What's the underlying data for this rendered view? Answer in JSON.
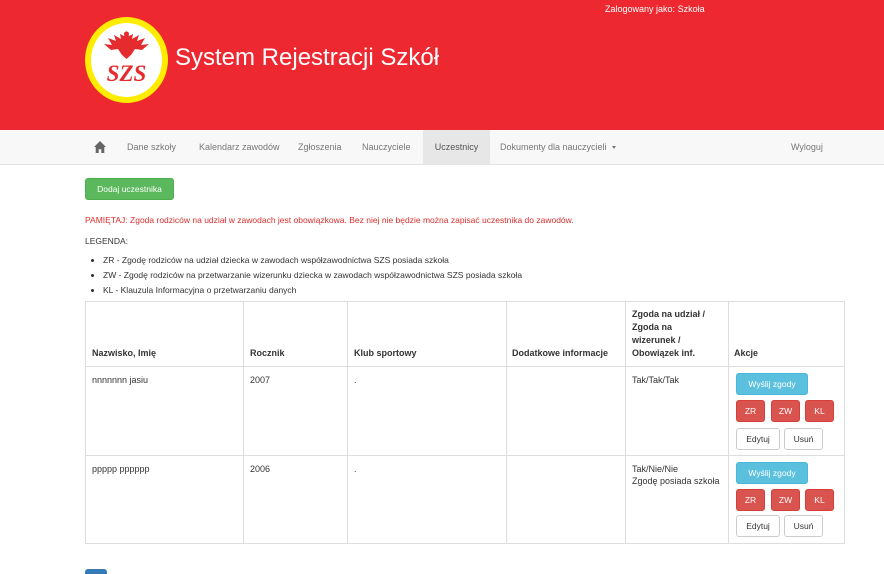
{
  "header": {
    "login_label": "Zalogowany jako:",
    "login_user": "Szkoła",
    "logo_text": "SZS",
    "title": "System Rejestracji Szkół"
  },
  "nav": {
    "items": [
      {
        "label": "Dane szkoły"
      },
      {
        "label": "Kalendarz zawodów"
      },
      {
        "label": "Zgłoszenia"
      },
      {
        "label": "Nauczyciele"
      },
      {
        "label": "Uczestnicy"
      },
      {
        "label": "Dokumenty dla nauczycieli"
      }
    ],
    "logout": "Wyloguj",
    "active": "Uczestnicy"
  },
  "main": {
    "add_button": "Dodaj uczestnika",
    "warning": "PAMIĘTAJ: Zgoda rodziców na udział w zawodach jest obowiązkowa. Bez niej nie będzie można zapisać uczestnika do zawodów.",
    "legend_title": "LEGENDA:",
    "legend": [
      "ZR - Zgodę rodziców na udział dziecka w zawodach współzawodnictwa SZS posiada szkoła",
      "ZW - Zgodę rodziców na przetwarzanie wizerunku dziecka w zawodach współzawodnictwa SZS posiada szkoła",
      "KL - Klauzula Informacyjna o przetwarzaniu danych"
    ]
  },
  "table": {
    "headers": {
      "name": "Nazwisko, Imię",
      "year": "Rocznik",
      "club": "Klub sportowy",
      "info": "Dodatkowe informacje",
      "consent_lines": [
        "Zgoda na udział /",
        "Zgoda na",
        "wizerunek /",
        "Obowiązek inf."
      ],
      "actions": "Akcje"
    },
    "rows": [
      {
        "name": "nnnnnnn jasiu",
        "year": "2007",
        "club": ".",
        "info": "",
        "consent": "Tak/Tak/Tak",
        "consent_note": ""
      },
      {
        "name": "ppppp pppppp",
        "year": "2006",
        "club": ".",
        "info": "",
        "consent": "Tak/Nie/Nie",
        "consent_note": "Zgodę posiada szkoła"
      }
    ],
    "actions": {
      "send": "Wyślij zgody",
      "zr": "ZR",
      "zw": "ZW",
      "kl": "KL",
      "edit": "Edytuj",
      "delete": "Usuń"
    }
  },
  "colors": {
    "header_bg": "#ee2830",
    "logo_ring": "#ffec00",
    "success": "#5cb85c",
    "info": "#5bc0de",
    "danger": "#d9534f",
    "warning_text": "#d9302c"
  }
}
